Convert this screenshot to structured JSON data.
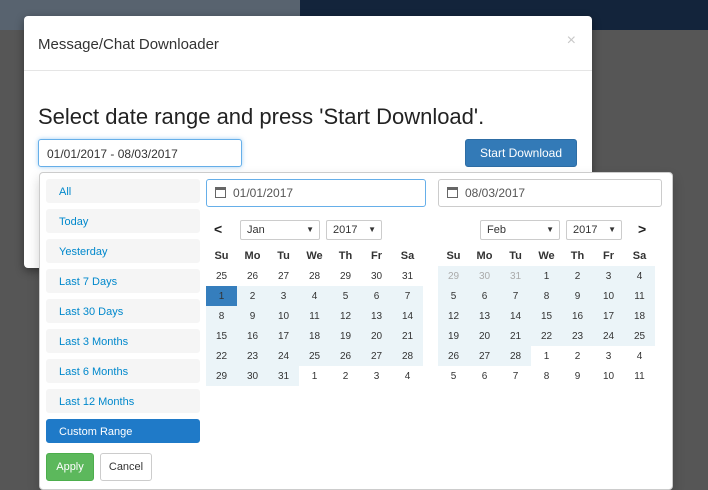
{
  "modal": {
    "title": "Message/Chat Downloader",
    "close": "×",
    "heading": "Select date range and press 'Start Download'.",
    "date_range_value": "01/01/2017 - 08/03/2017",
    "start_button": "Start Download"
  },
  "picker": {
    "ranges": [
      "All",
      "Today",
      "Yesterday",
      "Last 7 Days",
      "Last 30 Days",
      "Last 3 Months",
      "Last 6 Months",
      "Last 12 Months",
      "Custom Range"
    ],
    "active_range": "Custom Range",
    "apply_label": "Apply",
    "cancel_label": "Cancel",
    "weekdays": [
      "Su",
      "Mo",
      "Tu",
      "We",
      "Th",
      "Fr",
      "Sa"
    ],
    "prev_arrow": "<",
    "next_arrow": ">",
    "colors": {
      "accent": "#337ab7",
      "in_range": "#ebf4f8",
      "active": "#357ebd",
      "apply": "#5cb85c"
    },
    "left": {
      "input_value": "01/01/2017",
      "month": "Jan",
      "year": "2017",
      "weeks": [
        [
          "25",
          "26",
          "27",
          "28",
          "29",
          "30",
          "31"
        ],
        [
          "1",
          "2",
          "3",
          "4",
          "5",
          "6",
          "7"
        ],
        [
          "8",
          "9",
          "10",
          "11",
          "12",
          "13",
          "14"
        ],
        [
          "15",
          "16",
          "17",
          "18",
          "19",
          "20",
          "21"
        ],
        [
          "22",
          "23",
          "24",
          "25",
          "26",
          "27",
          "28"
        ],
        [
          "29",
          "30",
          "31",
          "1",
          "2",
          "3",
          "4"
        ]
      ]
    },
    "right": {
      "input_value": "08/03/2017",
      "month": "Feb",
      "year": "2017",
      "weeks": [
        [
          "29",
          "30",
          "31",
          "1",
          "2",
          "3",
          "4"
        ],
        [
          "5",
          "6",
          "7",
          "8",
          "9",
          "10",
          "11"
        ],
        [
          "12",
          "13",
          "14",
          "15",
          "16",
          "17",
          "18"
        ],
        [
          "19",
          "20",
          "21",
          "22",
          "23",
          "24",
          "25"
        ],
        [
          "26",
          "27",
          "28",
          "1",
          "2",
          "3",
          "4"
        ],
        [
          "5",
          "6",
          "7",
          "8",
          "9",
          "10",
          "11"
        ]
      ]
    }
  }
}
